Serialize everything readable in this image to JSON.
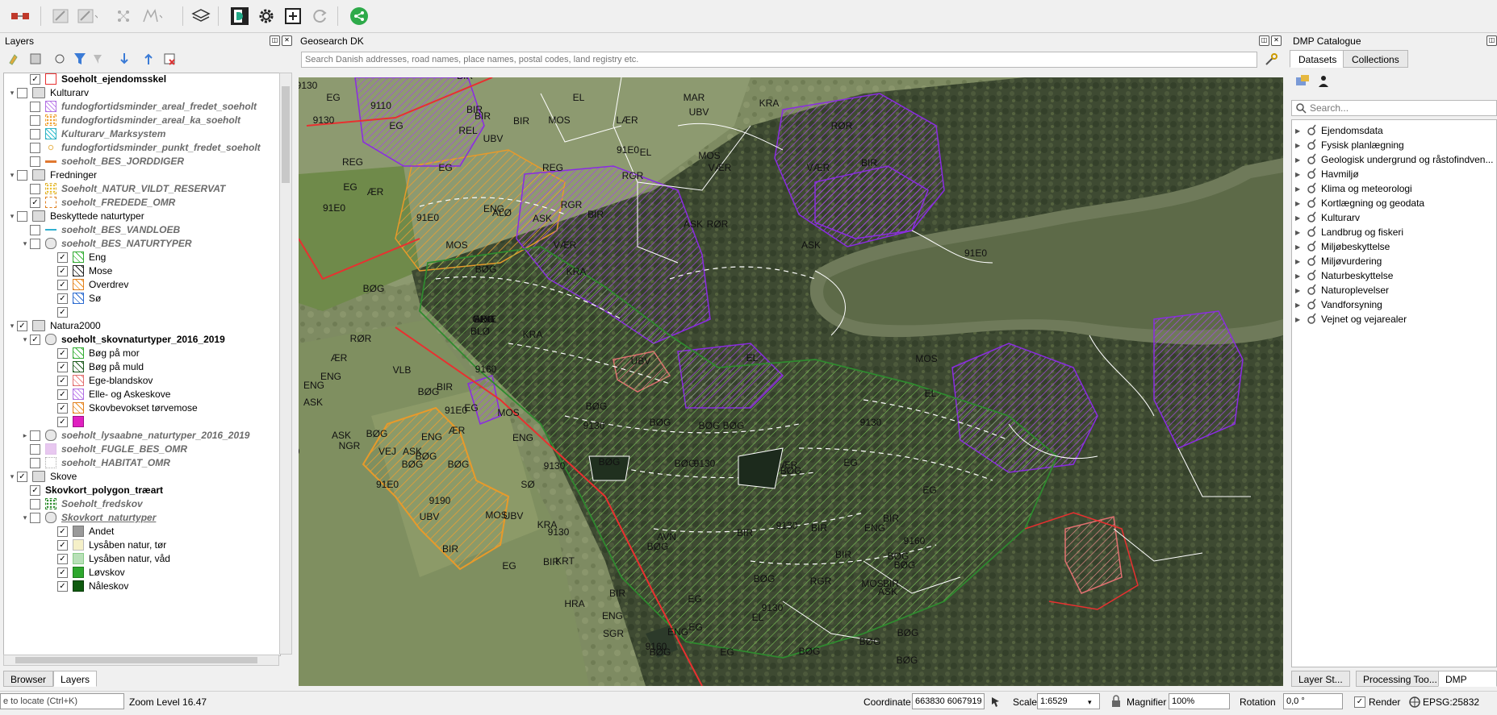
{
  "toolbar": {
    "icons": [
      "record-icon",
      "digitize-icon",
      "edit-icon",
      "node-tool-icon",
      "shape-tool-icon",
      "layers-icon",
      "dmp-icon",
      "settings-icon",
      "add-icon",
      "refresh-icon",
      "share-icon"
    ]
  },
  "layers_panel": {
    "title": "Layers",
    "rows": [
      {
        "label": "Soeholt_ejendomsskel",
        "style": "bold",
        "checked": true,
        "indent": 1,
        "arrow": "",
        "sym": "red-outline"
      },
      {
        "label": "Kulturarv",
        "style": "normal",
        "checked": false,
        "indent": 0,
        "arrow": "▾",
        "sym": "group"
      },
      {
        "label": "fundogfortidsminder_areal_fredet_soeholt",
        "style": "italic",
        "checked": false,
        "indent": 1,
        "arrow": "",
        "sym": "purple-hatch"
      },
      {
        "label": "fundogfortidsminder_areal_ka_soeholt",
        "style": "italic",
        "checked": false,
        "indent": 1,
        "arrow": "",
        "sym": "orange-dots"
      },
      {
        "label": "Kulturarv_Marksystem",
        "style": "italic",
        "checked": false,
        "indent": 1,
        "arrow": "",
        "sym": "cyan-hatch"
      },
      {
        "label": "fundogfortidsminder_punkt_fredet_soeholt",
        "style": "italic",
        "checked": false,
        "indent": 1,
        "arrow": "",
        "sym": "point"
      },
      {
        "label": "soeholt_BES_JORDDIGER",
        "style": "italic",
        "checked": false,
        "indent": 1,
        "arrow": "",
        "sym": "brown-line"
      },
      {
        "label": "Fredninger",
        "style": "normal",
        "checked": false,
        "indent": 0,
        "arrow": "▾",
        "sym": "group"
      },
      {
        "label": "Soeholt_NATUR_VILDT_RESERVAT",
        "style": "italic",
        "checked": false,
        "indent": 1,
        "arrow": "",
        "sym": "yellow-dots"
      },
      {
        "label": "soeholt_FREDEDE_OMR",
        "style": "italic",
        "checked": true,
        "indent": 1,
        "arrow": "",
        "sym": "orange-box"
      },
      {
        "label": "Beskyttede naturtyper",
        "style": "normal",
        "checked": false,
        "indent": 0,
        "arrow": "▾",
        "sym": "group"
      },
      {
        "label": "soeholt_BES_VANDLOEB",
        "style": "italic",
        "checked": false,
        "indent": 1,
        "arrow": "",
        "sym": "cyan-line"
      },
      {
        "label": "soeholt_BES_NATURTYPER",
        "style": "italic",
        "checked": false,
        "indent": 1,
        "arrow": "▾",
        "sym": "poly"
      },
      {
        "label": "Eng",
        "style": "normal",
        "checked": true,
        "indent": 2,
        "arrow": "",
        "sym": "green-hatch"
      },
      {
        "label": "Mose",
        "style": "normal",
        "checked": true,
        "indent": 2,
        "arrow": "",
        "sym": "black-hatch"
      },
      {
        "label": "Overdrev",
        "style": "normal",
        "checked": true,
        "indent": 2,
        "arrow": "",
        "sym": "orange-hatch"
      },
      {
        "label": "Sø",
        "style": "normal",
        "checked": true,
        "indent": 2,
        "arrow": "",
        "sym": "blue-hatch"
      },
      {
        "label": "",
        "style": "normal",
        "checked": true,
        "indent": 2,
        "arrow": "",
        "sym": "none"
      },
      {
        "label": "Natura2000",
        "style": "normal",
        "checked": true,
        "indent": 0,
        "arrow": "▾",
        "sym": "group"
      },
      {
        "label": "soeholt_skovnaturtyper_2016_2019",
        "style": "bold",
        "checked": true,
        "indent": 1,
        "arrow": "▾",
        "sym": "poly"
      },
      {
        "label": "Bøg på mor",
        "style": "normal",
        "checked": true,
        "indent": 2,
        "arrow": "",
        "sym": "green-hatch"
      },
      {
        "label": "Bøg på muld",
        "style": "normal",
        "checked": true,
        "indent": 2,
        "arrow": "",
        "sym": "darkgreen-hatch"
      },
      {
        "label": "Ege-blandskov",
        "style": "normal",
        "checked": true,
        "indent": 2,
        "arrow": "",
        "sym": "pink-hatch"
      },
      {
        "label": "Elle- og Askeskove",
        "style": "normal",
        "checked": true,
        "indent": 2,
        "arrow": "",
        "sym": "purple-hatch"
      },
      {
        "label": "Skovbevokset tørvemose",
        "style": "normal",
        "checked": true,
        "indent": 2,
        "arrow": "",
        "sym": "orange-hatch"
      },
      {
        "label": "",
        "style": "normal",
        "checked": true,
        "indent": 2,
        "arrow": "",
        "sym": "magenta"
      },
      {
        "label": "soeholt_lysaabne_naturtyper_2016_2019",
        "style": "italic",
        "checked": false,
        "indent": 1,
        "arrow": "▸",
        "sym": "poly"
      },
      {
        "label": "soeholt_FUGLE_BES_OMR",
        "style": "italic",
        "checked": false,
        "indent": 1,
        "arrow": "",
        "sym": "lilac"
      },
      {
        "label": "soeholt_HABITAT_OMR",
        "style": "italic",
        "checked": false,
        "indent": 1,
        "arrow": "",
        "sym": "white-box"
      },
      {
        "label": "Skove",
        "style": "normal",
        "checked": true,
        "indent": 0,
        "arrow": "▾",
        "sym": "group"
      },
      {
        "label": "Skovkort_polygon_træart",
        "style": "bold",
        "checked": true,
        "indent": 1,
        "arrow": "",
        "sym": "none"
      },
      {
        "label": "Soeholt_fredskov",
        "style": "italic",
        "checked": false,
        "indent": 1,
        "arrow": "",
        "sym": "green-dots"
      },
      {
        "label": "Skovkort_naturtyper",
        "style": "italic-u",
        "checked": false,
        "indent": 1,
        "arrow": "▾",
        "sym": "poly"
      },
      {
        "label": "Andet",
        "style": "normal",
        "checked": true,
        "indent": 2,
        "arrow": "",
        "sym": "gray"
      },
      {
        "label": "Lysåben natur, tør",
        "style": "normal",
        "checked": true,
        "indent": 2,
        "arrow": "",
        "sym": "cream"
      },
      {
        "label": "Lysåben natur, våd",
        "style": "normal",
        "checked": true,
        "indent": 2,
        "arrow": "",
        "sym": "mint"
      },
      {
        "label": "Løvskov",
        "style": "normal",
        "checked": true,
        "indent": 2,
        "arrow": "",
        "sym": "green"
      },
      {
        "label": "Nåleskov",
        "style": "normal",
        "checked": true,
        "indent": 2,
        "arrow": "",
        "sym": "darkgreen"
      }
    ]
  },
  "bottom_left_tabs": [
    "Browser",
    "Layers"
  ],
  "geosearch": {
    "title": "Geosearch DK",
    "placeholder": "Search Danish addresses, road names, place names, postal codes, land registry etc."
  },
  "dmp": {
    "title": "DMP Catalogue",
    "tabs": [
      "Datasets",
      "Collections"
    ],
    "search_placeholder": "Search...",
    "items": [
      "Ejendomsdata",
      "Fysisk planlægning",
      "Geologisk undergrund og råstofindven...",
      "Havmiljø",
      "Klima og meteorologi",
      "Kortlægning og geodata",
      "Kulturarv",
      "Landbrug og fiskeri",
      "Miljøbeskyttelse",
      "Miljøvurdering",
      "Naturbeskyttelse",
      "Naturoplevelser",
      "Vandforsyning",
      "Vejnet og vejarealer"
    ],
    "bottom_tabs": [
      "Layer St...",
      "Processing Too...",
      "DMP Catalo..."
    ]
  },
  "map_labels": [
    {
      "t": "EL"
    },
    {
      "t": "9130"
    },
    {
      "t": "EG"
    },
    {
      "t": "9110"
    },
    {
      "t": "BIR"
    },
    {
      "t": "UBV"
    },
    {
      "t": "EL"
    },
    {
      "t": "MAR"
    },
    {
      "t": "KRA"
    },
    {
      "t": "ENG"
    },
    {
      "t": "BIR"
    },
    {
      "t": "9130"
    },
    {
      "t": "EG"
    },
    {
      "t": "REL"
    },
    {
      "t": "BIR"
    },
    {
      "t": "BIR"
    },
    {
      "t": "MOS"
    },
    {
      "t": "LÆR"
    },
    {
      "t": "UBV"
    },
    {
      "t": "RØR"
    },
    {
      "t": "91E0"
    },
    {
      "t": "MOS"
    },
    {
      "t": "UBV"
    },
    {
      "t": "91E0"
    },
    {
      "t": "EL"
    },
    {
      "t": "MOS"
    },
    {
      "t": "RGR"
    },
    {
      "t": "VÆR"
    },
    {
      "t": "VÆR"
    },
    {
      "t": "ENG"
    },
    {
      "t": "REG"
    },
    {
      "t": "EG"
    },
    {
      "t": "REG"
    },
    {
      "t": "BIR"
    },
    {
      "t": "EG"
    },
    {
      "t": "RGR"
    },
    {
      "t": "REL"
    },
    {
      "t": "ÆR"
    },
    {
      "t": "ALØ"
    },
    {
      "t": "91E0"
    },
    {
      "t": "ENG"
    },
    {
      "t": "91E0"
    },
    {
      "t": "BIR"
    },
    {
      "t": "ASK"
    },
    {
      "t": "ASK"
    },
    {
      "t": "RØR"
    },
    {
      "t": "MOS"
    },
    {
      "t": "91D0"
    },
    {
      "t": "91E0"
    },
    {
      "t": "UBV"
    },
    {
      "t": "MOS"
    },
    {
      "t": "VÆR"
    },
    {
      "t": "ASK"
    },
    {
      "t": "SØ"
    },
    {
      "t": "BØG"
    },
    {
      "t": "BØG"
    },
    {
      "t": "KRA"
    },
    {
      "t": "RØR"
    },
    {
      "t": "BØG"
    },
    {
      "t": "BØG"
    },
    {
      "t": "EL"
    },
    {
      "t": "BØG"
    },
    {
      "t": "9130"
    },
    {
      "t": "BLØ"
    },
    {
      "t": "KRA"
    },
    {
      "t": "RØR"
    },
    {
      "t": "VÆR"
    },
    {
      "t": "BØG"
    },
    {
      "t": "ÆR"
    },
    {
      "t": "ENG"
    },
    {
      "t": "UBV"
    },
    {
      "t": "VLB"
    },
    {
      "t": "9160"
    },
    {
      "t": "EL"
    },
    {
      "t": "BIR"
    },
    {
      "t": "MOS"
    },
    {
      "t": "91E0"
    },
    {
      "t": "ENG"
    },
    {
      "t": "UBV"
    },
    {
      "t": "BØG"
    },
    {
      "t": "MOS"
    },
    {
      "t": "BØG"
    },
    {
      "t": "9130"
    },
    {
      "t": "ASK"
    },
    {
      "t": "91E0"
    },
    {
      "t": "EG"
    },
    {
      "t": "9130"
    },
    {
      "t": "BØG"
    },
    {
      "t": "BØG"
    },
    {
      "t": "9130"
    },
    {
      "t": "BØG"
    },
    {
      "t": "9130"
    },
    {
      "t": "EL"
    },
    {
      "t": "91E0"
    },
    {
      "t": "ASK"
    },
    {
      "t": "BØG"
    },
    {
      "t": "ENG"
    },
    {
      "t": "ÆR"
    },
    {
      "t": "ENG"
    },
    {
      "t": "SØ"
    },
    {
      "t": "VEJ"
    },
    {
      "t": "ASK"
    },
    {
      "t": "BØG"
    },
    {
      "t": "9130"
    },
    {
      "t": "NGR"
    },
    {
      "t": "BØG"
    },
    {
      "t": "BØG"
    },
    {
      "t": "9130"
    },
    {
      "t": "BØG"
    },
    {
      "t": "BØG"
    },
    {
      "t": "EG"
    },
    {
      "t": "BØG"
    },
    {
      "t": "ÆR"
    },
    {
      "t": "91E0"
    },
    {
      "t": "9190"
    },
    {
      "t": "UBV"
    },
    {
      "t": "MOS"
    },
    {
      "t": "KRA"
    },
    {
      "t": "UBV"
    },
    {
      "t": "9130"
    },
    {
      "t": "BØG"
    },
    {
      "t": "9130"
    },
    {
      "t": "ENG"
    },
    {
      "t": "EG"
    },
    {
      "t": "BIR"
    },
    {
      "t": "KRT"
    },
    {
      "t": "AVN"
    },
    {
      "t": "BIR"
    },
    {
      "t": "BIR"
    },
    {
      "t": "BIR"
    },
    {
      "t": "BIR"
    },
    {
      "t": "9160"
    },
    {
      "t": "EG"
    },
    {
      "t": "BIR"
    },
    {
      "t": "BØG"
    },
    {
      "t": "BØG"
    },
    {
      "t": "RGR"
    },
    {
      "t": "HRA"
    },
    {
      "t": "BIR"
    },
    {
      "t": "EG"
    },
    {
      "t": "BØG"
    },
    {
      "t": "9130"
    },
    {
      "t": "MOS"
    },
    {
      "t": "BIR"
    },
    {
      "t": "ASK"
    },
    {
      "t": "ENG"
    },
    {
      "t": "ENG"
    },
    {
      "t": "EG"
    },
    {
      "t": "EL"
    },
    {
      "t": "BØG"
    },
    {
      "t": "SGR"
    },
    {
      "t": "BØG"
    },
    {
      "t": "EG"
    },
    {
      "t": "9160"
    },
    {
      "t": "BØG"
    },
    {
      "t": "BØG"
    },
    {
      "t": "BØG"
    },
    {
      "t": "ALØ"
    },
    {
      "t": "ENG"
    },
    {
      "t": "BØG"
    },
    {
      "t": "GRÆ"
    }
  ],
  "statusbar": {
    "locate_placeholder": "e to locate (Ctrl+K)",
    "zoom_text": "Zoom Level 16.47",
    "coordinate_label": "Coordinate",
    "coordinate_value": "663830 6067919",
    "scale_label": "Scale",
    "scale_value": "1:6529",
    "magnifier_label": "Magnifier",
    "magnifier_value": "100%",
    "rotation_label": "Rotation",
    "rotation_value": "0,0 °",
    "render_label": "Render",
    "epsg": "EPSG:25832"
  }
}
